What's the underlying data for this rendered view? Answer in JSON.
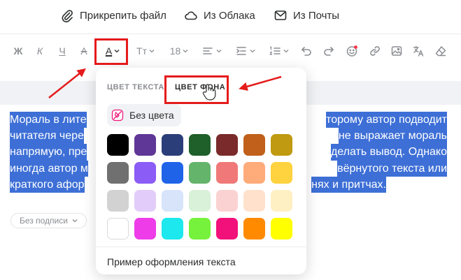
{
  "attach_bar": {
    "attach_file": "Прикрепить файл",
    "from_cloud": "Из Облака",
    "from_mail": "Из Почты"
  },
  "toolbar": {
    "bold": "Ж",
    "italic": "К",
    "underline": "Ч",
    "strike": "А",
    "text_color": "А",
    "font_family": "Тт",
    "font_size": "18"
  },
  "body": {
    "lines": [
      {
        "left": "Мораль в лите",
        "right": "торому автор подводит"
      },
      {
        "left": "читателя чере",
        "right": "не выражает мораль"
      },
      {
        "left": "напрямую, пре",
        "right": "делать вывод. Однако"
      },
      {
        "left": "иногда автор м",
        "right": "вёрнутого текста или"
      },
      {
        "left": "краткого афор",
        "right": "нях и притчах."
      }
    ]
  },
  "signature": {
    "label": "Без подписи"
  },
  "color_popover": {
    "tab_text_color": "ЦВЕТ ТЕКСТА",
    "tab_bg_color": "ЦВЕТ ФОНА",
    "no_color": "Без цвета",
    "preview": "Пример оформления текста",
    "swatches": [
      [
        "#000000",
        "#5f3797",
        "#2c3e7a",
        "#1f5f2a",
        "#7a2a2a",
        "#c0601a",
        "#c09a10"
      ],
      [
        "#707070",
        "#8b5cf6",
        "#1f64e8",
        "#65b46b",
        "#f07878",
        "#ffab7a",
        "#ffd23f"
      ],
      [
        "#d2d2d2",
        "#e2cdfa",
        "#d7e4fa",
        "#d8f1d8",
        "#fbd2d2",
        "#ffe1cc",
        "#fff0c4"
      ],
      [
        "#ffffff",
        "#ee3ce9",
        "#1ce8ee",
        "#76f23c",
        "#f2117a",
        "#ff8a00",
        "#ffff00"
      ]
    ]
  },
  "colors": {
    "highlight": "#3d6fd6",
    "annotation_red": "#e51b1b",
    "icon_gray": "#8b8d92"
  }
}
